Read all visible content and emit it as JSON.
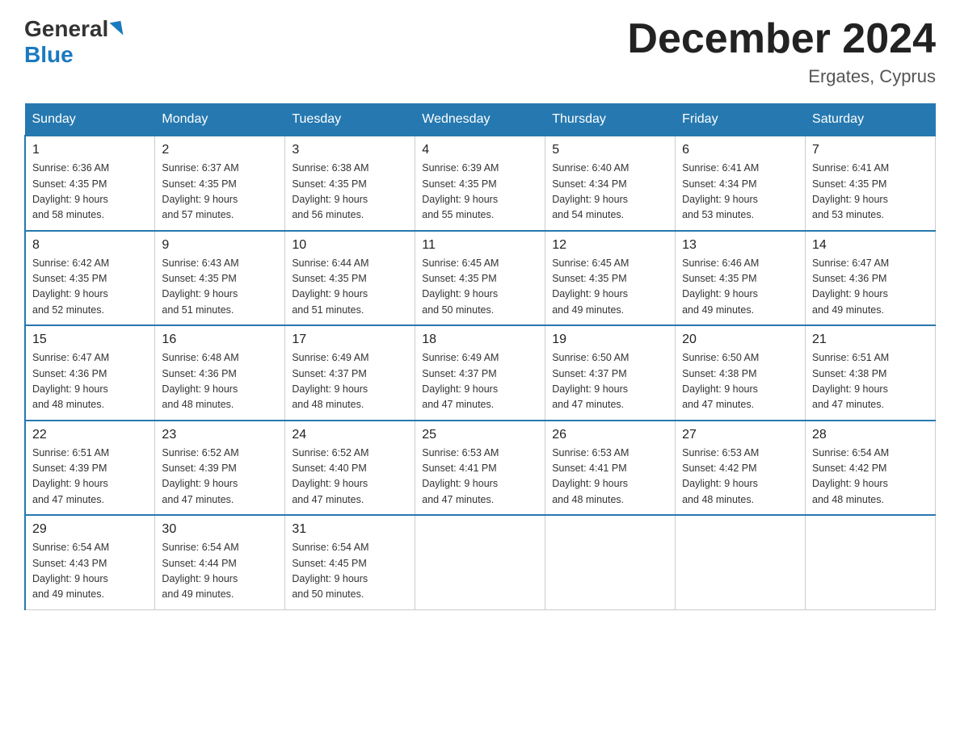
{
  "logo": {
    "general": "General",
    "blue": "Blue"
  },
  "title": "December 2024",
  "subtitle": "Ergates, Cyprus",
  "days_of_week": [
    "Sunday",
    "Monday",
    "Tuesday",
    "Wednesday",
    "Thursday",
    "Friday",
    "Saturday"
  ],
  "weeks": [
    [
      {
        "day": "1",
        "sunrise": "6:36 AM",
        "sunset": "4:35 PM",
        "daylight": "9 hours and 58 minutes."
      },
      {
        "day": "2",
        "sunrise": "6:37 AM",
        "sunset": "4:35 PM",
        "daylight": "9 hours and 57 minutes."
      },
      {
        "day": "3",
        "sunrise": "6:38 AM",
        "sunset": "4:35 PM",
        "daylight": "9 hours and 56 minutes."
      },
      {
        "day": "4",
        "sunrise": "6:39 AM",
        "sunset": "4:35 PM",
        "daylight": "9 hours and 55 minutes."
      },
      {
        "day": "5",
        "sunrise": "6:40 AM",
        "sunset": "4:34 PM",
        "daylight": "9 hours and 54 minutes."
      },
      {
        "day": "6",
        "sunrise": "6:41 AM",
        "sunset": "4:34 PM",
        "daylight": "9 hours and 53 minutes."
      },
      {
        "day": "7",
        "sunrise": "6:41 AM",
        "sunset": "4:35 PM",
        "daylight": "9 hours and 53 minutes."
      }
    ],
    [
      {
        "day": "8",
        "sunrise": "6:42 AM",
        "sunset": "4:35 PM",
        "daylight": "9 hours and 52 minutes."
      },
      {
        "day": "9",
        "sunrise": "6:43 AM",
        "sunset": "4:35 PM",
        "daylight": "9 hours and 51 minutes."
      },
      {
        "day": "10",
        "sunrise": "6:44 AM",
        "sunset": "4:35 PM",
        "daylight": "9 hours and 51 minutes."
      },
      {
        "day": "11",
        "sunrise": "6:45 AM",
        "sunset": "4:35 PM",
        "daylight": "9 hours and 50 minutes."
      },
      {
        "day": "12",
        "sunrise": "6:45 AM",
        "sunset": "4:35 PM",
        "daylight": "9 hours and 49 minutes."
      },
      {
        "day": "13",
        "sunrise": "6:46 AM",
        "sunset": "4:35 PM",
        "daylight": "9 hours and 49 minutes."
      },
      {
        "day": "14",
        "sunrise": "6:47 AM",
        "sunset": "4:36 PM",
        "daylight": "9 hours and 49 minutes."
      }
    ],
    [
      {
        "day": "15",
        "sunrise": "6:47 AM",
        "sunset": "4:36 PM",
        "daylight": "9 hours and 48 minutes."
      },
      {
        "day": "16",
        "sunrise": "6:48 AM",
        "sunset": "4:36 PM",
        "daylight": "9 hours and 48 minutes."
      },
      {
        "day": "17",
        "sunrise": "6:49 AM",
        "sunset": "4:37 PM",
        "daylight": "9 hours and 48 minutes."
      },
      {
        "day": "18",
        "sunrise": "6:49 AM",
        "sunset": "4:37 PM",
        "daylight": "9 hours and 47 minutes."
      },
      {
        "day": "19",
        "sunrise": "6:50 AM",
        "sunset": "4:37 PM",
        "daylight": "9 hours and 47 minutes."
      },
      {
        "day": "20",
        "sunrise": "6:50 AM",
        "sunset": "4:38 PM",
        "daylight": "9 hours and 47 minutes."
      },
      {
        "day": "21",
        "sunrise": "6:51 AM",
        "sunset": "4:38 PM",
        "daylight": "9 hours and 47 minutes."
      }
    ],
    [
      {
        "day": "22",
        "sunrise": "6:51 AM",
        "sunset": "4:39 PM",
        "daylight": "9 hours and 47 minutes."
      },
      {
        "day": "23",
        "sunrise": "6:52 AM",
        "sunset": "4:39 PM",
        "daylight": "9 hours and 47 minutes."
      },
      {
        "day": "24",
        "sunrise": "6:52 AM",
        "sunset": "4:40 PM",
        "daylight": "9 hours and 47 minutes."
      },
      {
        "day": "25",
        "sunrise": "6:53 AM",
        "sunset": "4:41 PM",
        "daylight": "9 hours and 47 minutes."
      },
      {
        "day": "26",
        "sunrise": "6:53 AM",
        "sunset": "4:41 PM",
        "daylight": "9 hours and 48 minutes."
      },
      {
        "day": "27",
        "sunrise": "6:53 AM",
        "sunset": "4:42 PM",
        "daylight": "9 hours and 48 minutes."
      },
      {
        "day": "28",
        "sunrise": "6:54 AM",
        "sunset": "4:42 PM",
        "daylight": "9 hours and 48 minutes."
      }
    ],
    [
      {
        "day": "29",
        "sunrise": "6:54 AM",
        "sunset": "4:43 PM",
        "daylight": "9 hours and 49 minutes."
      },
      {
        "day": "30",
        "sunrise": "6:54 AM",
        "sunset": "4:44 PM",
        "daylight": "9 hours and 49 minutes."
      },
      {
        "day": "31",
        "sunrise": "6:54 AM",
        "sunset": "4:45 PM",
        "daylight": "9 hours and 50 minutes."
      },
      null,
      null,
      null,
      null
    ]
  ],
  "label_sunrise": "Sunrise:",
  "label_sunset": "Sunset:",
  "label_daylight": "Daylight:"
}
